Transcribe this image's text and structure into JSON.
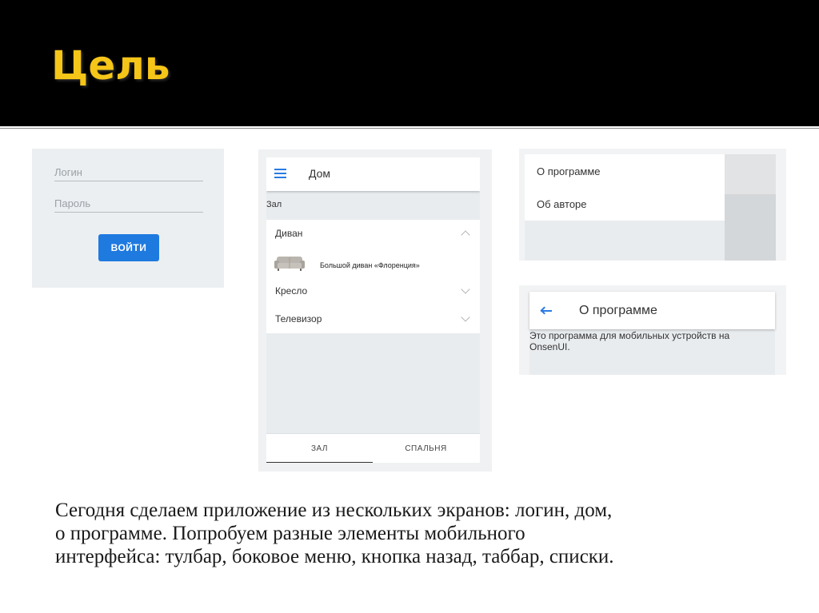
{
  "slide": {
    "title": "Цель"
  },
  "login_screen": {
    "login_placeholder": "Логин",
    "password_placeholder": "Пароль",
    "submit_label": "ВОЙТИ",
    "accent_color": "#1f7ae0"
  },
  "home_screen": {
    "toolbar_title": "Дом",
    "menu_icon": "hamburger-icon",
    "section_header": "Зал",
    "items": [
      {
        "label": "Диван",
        "expanded": true,
        "chevron": "chevron-up-icon"
      },
      {
        "label": "Кресло",
        "expanded": false,
        "chevron": "chevron-down-icon"
      },
      {
        "label": "Телевизор",
        "expanded": false,
        "chevron": "chevron-down-icon"
      }
    ],
    "expanded_content": {
      "label": "Большой диван «Флоренция»",
      "image_icon": "sofa-icon"
    },
    "tabs": [
      {
        "label": "ЗАЛ",
        "active": true
      },
      {
        "label": "СПАЛЬНЯ",
        "active": false
      }
    ]
  },
  "side_menu": {
    "items": [
      {
        "label": "О программе"
      },
      {
        "label": "Об авторе"
      }
    ]
  },
  "about_screen": {
    "toolbar_title": "О программе",
    "back_icon": "arrow-left-icon",
    "text_line1": "Это программа для мобильных устройств на",
    "text_line2": "OnsenUI."
  },
  "caption": {
    "line1": "Сегодня сделаем приложение из нескольких экранов: логин, дом,",
    "line2": "о программе. Попробуем разные элементы мобильного",
    "line3": "интерфейса: тулбар, боковое меню, кнопка назад, таббар, списки."
  }
}
